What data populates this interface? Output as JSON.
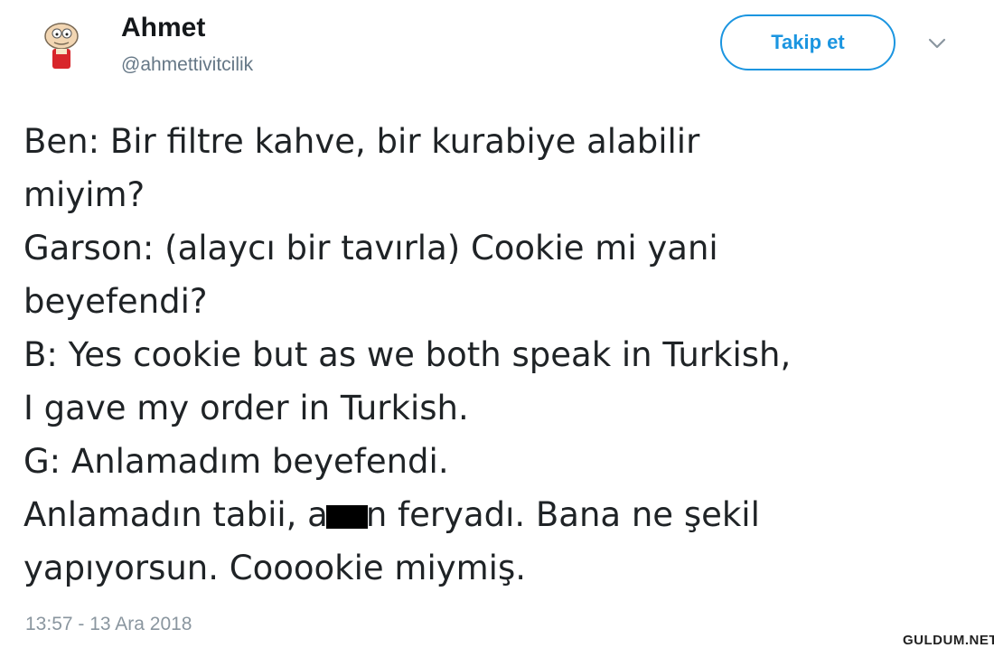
{
  "user": {
    "display_name": "Ahmet",
    "handle": "@ahmettivitcilik",
    "avatar_icon": "cartoon-avatar-icon"
  },
  "header": {
    "follow_label": "Takip et",
    "menu_icon": "chevron-down-icon",
    "accent_color": "#1b95e0"
  },
  "tweet": {
    "lines": [
      "Ben: Bir filtre kahve, bir kurabiye alabilir",
      "miyim?",
      "Garson: (alaycı bir tavırla) Cookie mi yani",
      "beyefendi?",
      "B: Yes cookie but as we both speak in Turkish,",
      "I gave my order in Turkish.",
      "G: Anlamadım beyefendi."
    ],
    "censored_line": {
      "before": "Anlamadın tabii, a",
      "after": "n feryadı. Bana ne şekil"
    },
    "last_line": "yapıyorsun. Cooookie miymiş.",
    "timestamp": "13:57 - 13 Ara 2018"
  },
  "watermark": "GULDUM.NET"
}
